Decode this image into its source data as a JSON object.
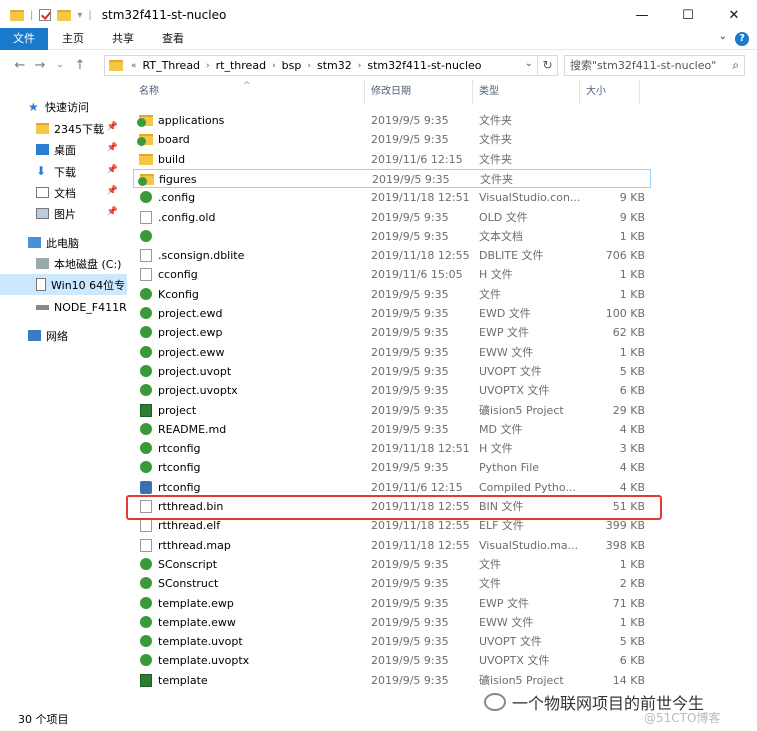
{
  "window": {
    "title": "stm32f411-st-nucleo",
    "controls": {
      "minimize": "—",
      "maximize": "☐",
      "close": "✕"
    }
  },
  "ribbon": {
    "tabs": [
      "文件",
      "主页",
      "共享",
      "查看"
    ],
    "help": "?"
  },
  "address": {
    "prefix": "«",
    "crumbs": [
      "RT_Thread",
      "rt_thread",
      "bsp",
      "stm32",
      "stm32f411-st-nucleo"
    ],
    "search_placeholder": "搜索\"stm32f411-st-nucleo\""
  },
  "nav": {
    "quick_access": "快速访问",
    "items": [
      {
        "label": "2345下载",
        "icon": "folder-icon",
        "pinned": true
      },
      {
        "label": "桌面",
        "icon": "desktop-icon",
        "pinned": true
      },
      {
        "label": "下载",
        "icon": "download-icon",
        "pinned": true
      },
      {
        "label": "文档",
        "icon": "documents-icon",
        "pinned": true
      },
      {
        "label": "图片",
        "icon": "pictures-icon",
        "pinned": true
      }
    ],
    "this_pc": "此电脑",
    "drives": [
      {
        "label": "本地磁盘 (C:)",
        "icon": "drive-icon"
      },
      {
        "label": "Win10 64位专",
        "icon": "drive-icon",
        "selected": true
      },
      {
        "label": "NODE_F411R",
        "icon": "usb-drive-icon"
      }
    ],
    "network": "网络"
  },
  "columns": {
    "name": "名称",
    "date": "修改日期",
    "type": "类型",
    "size": "大小"
  },
  "files": [
    {
      "name": "applications",
      "date": "2019/9/5 9:35",
      "type": "文件夹",
      "size": "",
      "icon": "folder-green"
    },
    {
      "name": "board",
      "date": "2019/9/5 9:35",
      "type": "文件夹",
      "size": "",
      "icon": "folder-green"
    },
    {
      "name": "build",
      "date": "2019/11/6 12:15",
      "type": "文件夹",
      "size": "",
      "icon": "folder"
    },
    {
      "name": "figures",
      "date": "2019/9/5 9:35",
      "type": "文件夹",
      "size": "",
      "icon": "folder-green",
      "hover": true
    },
    {
      "name": ".config",
      "date": "2019/11/18 12:51",
      "type": "VisualStudio.con...",
      "size": "9 KB",
      "icon": "vs"
    },
    {
      "name": ".config.old",
      "date": "2019/9/5 9:35",
      "type": "OLD 文件",
      "size": "9 KB",
      "icon": "file"
    },
    {
      "name": "",
      "date": "2019/9/5 9:35",
      "type": "文本文档",
      "size": "1 KB",
      "icon": "vs"
    },
    {
      "name": ".sconsign.dblite",
      "date": "2019/11/18 12:55",
      "type": "DBLITE 文件",
      "size": "706 KB",
      "icon": "file"
    },
    {
      "name": "cconfig",
      "date": "2019/11/6 15:05",
      "type": "H 文件",
      "size": "1 KB",
      "icon": "file"
    },
    {
      "name": "Kconfig",
      "date": "2019/9/5 9:35",
      "type": "文件",
      "size": "1 KB",
      "icon": "vs"
    },
    {
      "name": "project.ewd",
      "date": "2019/9/5 9:35",
      "type": "EWD 文件",
      "size": "100 KB",
      "icon": "vs"
    },
    {
      "name": "project.ewp",
      "date": "2019/9/5 9:35",
      "type": "EWP 文件",
      "size": "62 KB",
      "icon": "vs"
    },
    {
      "name": "project.eww",
      "date": "2019/9/5 9:35",
      "type": "EWW 文件",
      "size": "1 KB",
      "icon": "vs"
    },
    {
      "name": "project.uvopt",
      "date": "2019/9/5 9:35",
      "type": "UVOPT 文件",
      "size": "5 KB",
      "icon": "vs"
    },
    {
      "name": "project.uvoptx",
      "date": "2019/9/5 9:35",
      "type": "UVOPTX 文件",
      "size": "6 KB",
      "icon": "vs"
    },
    {
      "name": "project",
      "date": "2019/9/5 9:35",
      "type": "礦ision5 Project",
      "size": "29 KB",
      "icon": "keil"
    },
    {
      "name": "README.md",
      "date": "2019/9/5 9:35",
      "type": "MD 文件",
      "size": "4 KB",
      "icon": "vs"
    },
    {
      "name": "rtconfig",
      "date": "2019/11/18 12:51",
      "type": "H 文件",
      "size": "3 KB",
      "icon": "vs"
    },
    {
      "name": "rtconfig",
      "date": "2019/9/5 9:35",
      "type": "Python File",
      "size": "4 KB",
      "icon": "vs"
    },
    {
      "name": "rtconfig",
      "date": "2019/11/6 12:15",
      "type": "Compiled Pytho...",
      "size": "4 KB",
      "icon": "py"
    },
    {
      "name": "rtthread.bin",
      "date": "2019/11/18 12:55",
      "type": "BIN 文件",
      "size": "51 KB",
      "icon": "file",
      "highlighted": true
    },
    {
      "name": "rtthread.elf",
      "date": "2019/11/18 12:55",
      "type": "ELF 文件",
      "size": "399 KB",
      "icon": "file"
    },
    {
      "name": "rtthread.map",
      "date": "2019/11/18 12:55",
      "type": "VisualStudio.ma...",
      "size": "398 KB",
      "icon": "file"
    },
    {
      "name": "SConscript",
      "date": "2019/9/5 9:35",
      "type": "文件",
      "size": "1 KB",
      "icon": "vs"
    },
    {
      "name": "SConstruct",
      "date": "2019/9/5 9:35",
      "type": "文件",
      "size": "2 KB",
      "icon": "vs"
    },
    {
      "name": "template.ewp",
      "date": "2019/9/5 9:35",
      "type": "EWP 文件",
      "size": "71 KB",
      "icon": "vs"
    },
    {
      "name": "template.eww",
      "date": "2019/9/5 9:35",
      "type": "EWW 文件",
      "size": "1 KB",
      "icon": "vs"
    },
    {
      "name": "template.uvopt",
      "date": "2019/9/5 9:35",
      "type": "UVOPT 文件",
      "size": "5 KB",
      "icon": "vs"
    },
    {
      "name": "template.uvoptx",
      "date": "2019/9/5 9:35",
      "type": "UVOPTX 文件",
      "size": "6 KB",
      "icon": "vs"
    },
    {
      "name": "template",
      "date": "2019/9/5 9:35",
      "type": "礦ision5 Project",
      "size": "14 KB",
      "icon": "keil"
    }
  ],
  "status": {
    "count": "30 个项目"
  },
  "watermark": {
    "text": "一个物联网项目的前世今生",
    "sub": "@51CTO博客"
  }
}
